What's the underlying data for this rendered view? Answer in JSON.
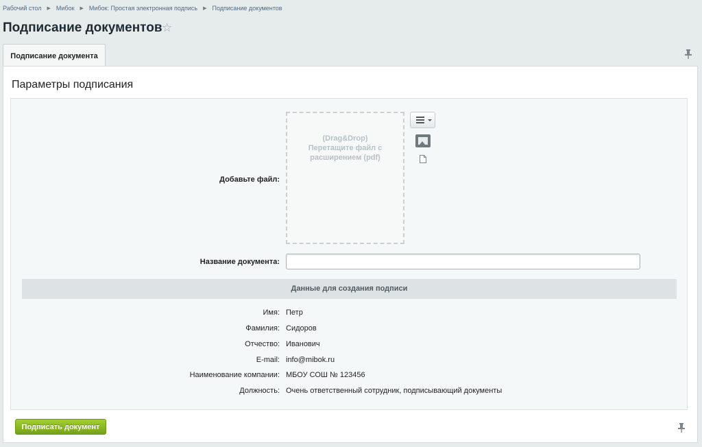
{
  "breadcrumb": [
    "Рабочий стол",
    "Мибок",
    "Мибок: Простая электронная подпись",
    "Подписание документов"
  ],
  "page": {
    "title": "Подписание документов"
  },
  "tabs": [
    {
      "label": "Подписание документа",
      "active": true
    }
  ],
  "section": {
    "title": "Параметры подписания"
  },
  "upload": {
    "label": "Добавьте файл:",
    "dropzone_lines": [
      "(Drag&Drop)",
      "Перетащите файл с",
      "расширением (pdf)"
    ]
  },
  "doc_name": {
    "label": "Название документа:",
    "value": "",
    "placeholder": ""
  },
  "signature": {
    "header": "Данные для создания подписи",
    "fields": [
      {
        "label": "Имя:",
        "value": "Петр"
      },
      {
        "label": "Фамилия:",
        "value": "Сидоров"
      },
      {
        "label": "Отчество:",
        "value": "Иванович"
      },
      {
        "label": "E-mail:",
        "value": "info@mibok.ru"
      },
      {
        "label": "Наименование компании:",
        "value": "МБОУ СОШ № 123456"
      },
      {
        "label": "Должность:",
        "value": "Очень ответственный сотрудник, подписывающий документы"
      }
    ]
  },
  "actions": {
    "submit_label": "Подписать документ"
  },
  "colors": {
    "accent_green": "#8bbd22",
    "link": "#4b6a85"
  },
  "icons": [
    "star-icon",
    "pin-icon",
    "menu-icon",
    "image-icon",
    "file-icon"
  ]
}
